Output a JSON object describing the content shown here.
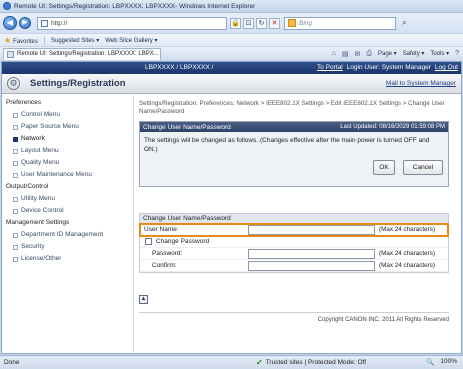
{
  "window": {
    "title": "Remote UI: Settings/Registration: LBPXXXX: LBPXXXX- Windows Internet Explorer",
    "url": "http://",
    "search_placeholder": "Bing"
  },
  "favorites_bar": {
    "favorites": "Favorites",
    "suggested": "Suggested Sites ▾",
    "gallery": "Web Slice Gallery ▾"
  },
  "tab": {
    "label": "Remote UI: Settings/Registration: LBPXXXX: LBPX..."
  },
  "command_bar": {
    "page": "Page ▾",
    "safety": "Safety ▾",
    "tools": "Tools ▾"
  },
  "header": {
    "device": "LBPXXXX / LBPXXXX /",
    "to_portal": "To Portal",
    "login_user": "Login User: System Manager",
    "log_out": "Log Out",
    "title": "Settings/Registration",
    "mail": "Mail to System Manager"
  },
  "sidebar": {
    "sections": [
      {
        "heading": "Preferences",
        "items": [
          "Control Menu",
          "Paper Source Menu",
          "Network",
          "Layout Menu",
          "Quality Menu",
          "User Maintenance Menu"
        ]
      },
      {
        "heading": "Output/Control",
        "items": [
          "Utility Menu",
          "Device Control"
        ]
      },
      {
        "heading": "Management Settings",
        "items": [
          "Department ID Management",
          "Security",
          "License/Other"
        ]
      }
    ],
    "active": "Network"
  },
  "content": {
    "breadcrumb": "Settings/Registration: Preferences: Network > IEEE802.1X Settings > Edit IEEE802.1X Settings > Change User Name/Password",
    "dialog": {
      "title": "Change User Name/Password",
      "last_updated": "Last Updated: 08/16/2029 01:59:08 PM",
      "message": "The settings will be changed as follows. (Changes effective after the main power is turned OFF and ON.)",
      "ok": "OK",
      "cancel": "Cancel"
    },
    "form": {
      "heading": "Change User Name/Password",
      "username_label": "User Name:",
      "username_value": "",
      "username_hint": "(Max 24 characters)",
      "change_password_label": "Change Password",
      "password_label": "Password:",
      "password_hint": "(Max 24 characters)",
      "confirm_label": "Confirm:",
      "confirm_hint": "(Max 24 characters)"
    },
    "copyright": "Copyright CANON INC. 2011 All Rights Reserved"
  },
  "statusbar": {
    "left": "Done",
    "zone": "Trusted sites | Protected Mode: Off",
    "zoom": "100%"
  },
  "colors": {
    "highlight": "#e88a1a",
    "header_bg": "#1c356a"
  }
}
